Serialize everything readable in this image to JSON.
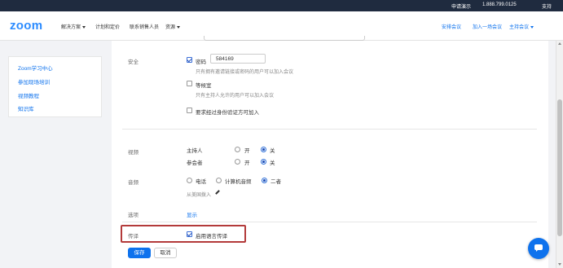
{
  "topbar": {
    "demo": "申请演示",
    "phone": "1.888.799.0125",
    "support": "支持"
  },
  "nav": {
    "logo": "zoom",
    "solutions": "解决方案",
    "plans": "计划和定价",
    "contact_sales": "联系销售人员",
    "resources": "资源",
    "schedule": "安排会议",
    "join": "加入一场会议",
    "host": "主持会议"
  },
  "sidebar": {
    "items": [
      {
        "label": "Zoom学习中心"
      },
      {
        "label": "参加现场培训"
      },
      {
        "label": "视频教程"
      },
      {
        "label": "知识库"
      }
    ]
  },
  "settings": {
    "security": {
      "label": "安全",
      "passcode_label": "密码",
      "passcode_value": "584169",
      "passcode_desc": "只有拥有邀请链接或密码的用户可以加入会议",
      "waiting_room_label": "等候室",
      "waiting_room_desc": "只有主持人允许的用户可以加入会议",
      "auth_label": "要求经过身份验证方可加入"
    },
    "video": {
      "label": "视频",
      "host_label": "主持人",
      "participant_label": "参会者",
      "on": "开",
      "off": "关"
    },
    "audio": {
      "label": "音频",
      "phone": "电话",
      "computer": "计算机音频",
      "both": "二者",
      "dial_from": "从美国拨入"
    },
    "options": {
      "label": "选项",
      "show": "显示"
    },
    "interpretation": {
      "label": "传译",
      "enable": "启用语言传译"
    }
  },
  "buttons": {
    "save": "保存",
    "cancel": "取消"
  },
  "colors": {
    "accent": "#0e72ed",
    "topbar": "#1f2b3f",
    "highlight": "#b33a3a"
  },
  "icons": {
    "chat": "chat-bubble-icon",
    "edit": "pencil-icon"
  }
}
